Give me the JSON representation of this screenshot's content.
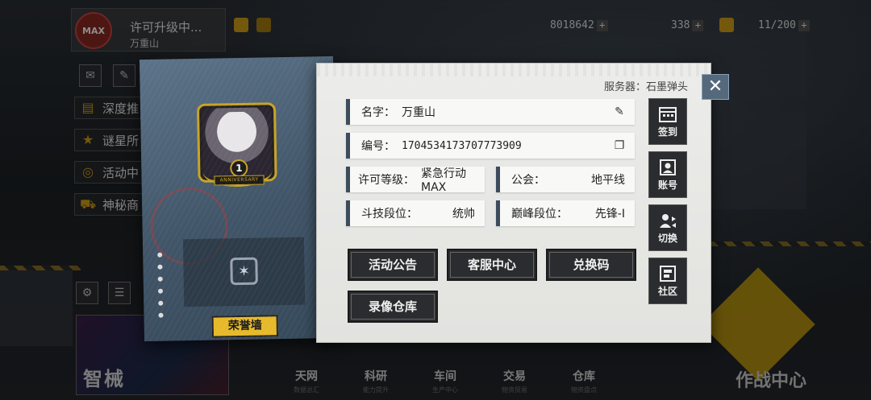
{
  "colors": {
    "accent_gold": "#e6b92a",
    "folder_blue": "#4a6076",
    "paper": "#e6e6e3",
    "button_dark": "#2a2c2f"
  },
  "top_bar": {
    "license_status": "许可升级中...",
    "player_name": "万重山",
    "max_badge": "MAX",
    "resource_1": "8018642",
    "resource_2": "338",
    "stamina": "11/200",
    "plus": "+"
  },
  "side_menu": {
    "items": [
      {
        "label": "深度推",
        "icon": "book-icon"
      },
      {
        "label": "谜星所",
        "icon": "star-icon"
      },
      {
        "label": "活动中",
        "icon": "target-icon"
      },
      {
        "label": "神秘商",
        "icon": "cart-icon"
      }
    ]
  },
  "bottom_nav": {
    "items": [
      {
        "label": "天网",
        "sub": "数据总汇"
      },
      {
        "label": "科研",
        "sub": "能力提升"
      },
      {
        "label": "车间",
        "sub": "生产中心"
      },
      {
        "label": "交易",
        "sub": "物资贸易"
      },
      {
        "label": "仓库",
        "sub": "物资盘点"
      }
    ],
    "combat_center": "作战中心"
  },
  "banner": {
    "text": "智械"
  },
  "profile": {
    "server_label": "服务器：",
    "server_value": "石墨弹头",
    "name_label": "名字：",
    "name_value": "万重山",
    "id_label": "编号：",
    "id_value": "1704534173707773909",
    "license_label": "许可等级：",
    "license_value": "紧急行动MAX",
    "guild_label": "公会：",
    "guild_value": "地平线",
    "arena_label": "斗技段位：",
    "arena_value": "统帅",
    "peak_label": "巅峰段位：",
    "peak_value": "先锋-Ⅰ",
    "avatar_badge_number": "1",
    "avatar_ribbon": "ANNIVERSARY"
  },
  "folder": {
    "honor_wall_button": "荣誉墙"
  },
  "actions": {
    "announcement": "活动公告",
    "customer_service": "客服中心",
    "redeem_code": "兑换码",
    "replay_storage": "录像仓库"
  },
  "side_tabs": {
    "checkin": "签到",
    "account": "账号",
    "switch": "切换",
    "community": "社区"
  },
  "close_symbol": "✕"
}
